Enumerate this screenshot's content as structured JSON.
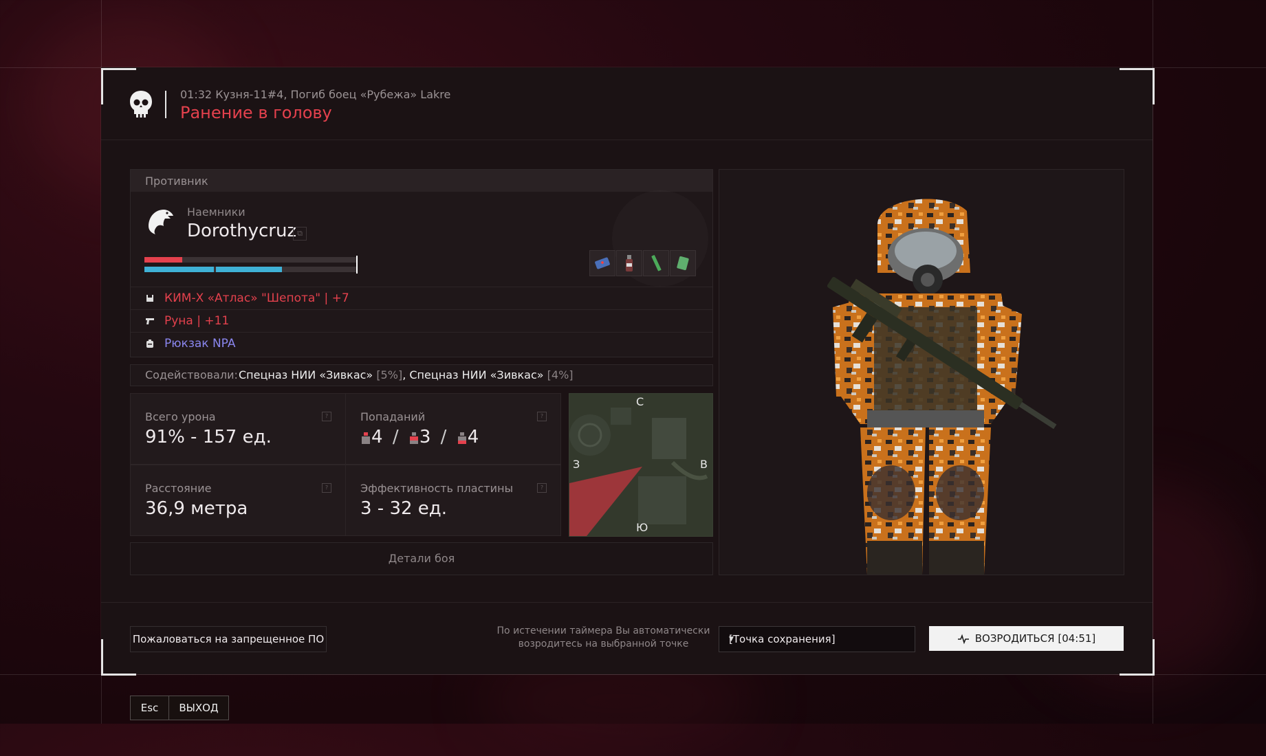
{
  "header": {
    "event_line": "01:32 Кузня-11#4, Погиб боец «Рубежа» Lakre",
    "cause": "Ранение в голову"
  },
  "enemy": {
    "section_title": "Противник",
    "faction": "Наемники",
    "name": "Dorothycruz",
    "health_fraction": 0.18,
    "armor_segments": 3,
    "armor_fraction": 0.65,
    "items": [
      "medkit-icon",
      "bottle-icon",
      "syringe-icon",
      "bandage-icon"
    ],
    "gear": [
      {
        "icon": "armor-icon",
        "text": "КИМ-Х «Атлас» \"Шепота\" | +7",
        "color": "#e4414d"
      },
      {
        "icon": "gun-icon",
        "text": "Руна | +11",
        "color": "#e4414d"
      },
      {
        "icon": "backpack-icon",
        "text": "Рюкзак NPA",
        "color": "#8a86ee"
      }
    ]
  },
  "assist": {
    "label": "Содействовали:",
    "p1": "Спецназ НИИ «Зивкас»",
    "p1_pct": "[5%]",
    "p2": "Спецназ НИИ «Зивкас»",
    "p2_pct": "[4%]"
  },
  "stats": {
    "damage_label": "Всего урона",
    "damage_value": "91% - 157 ед.",
    "hits_label": "Попаданий",
    "hits": [
      "4",
      "3",
      "4"
    ],
    "distance_label": "Расстояние",
    "distance_value": "36,9 метра",
    "plate_label": "Эффективность пластины",
    "plate_value": "3 - 32 ед."
  },
  "minimap": {
    "north": "С",
    "south": "Ю",
    "west": "З",
    "east": "В"
  },
  "details_button": "Детали боя",
  "footer": {
    "report_button": "Пожаловаться на запрещенное ПО",
    "timer_note": "По истечении таймера Вы автоматически возродитесь на выбранной точке",
    "spawn_select": "[Точка сохранения]",
    "respawn_button": "ВОЗРОДИТЬСЯ [04:51]"
  },
  "keys": {
    "esc": "Esc",
    "exit": "ВЫХОД"
  },
  "colors": {
    "accent_red": "#e4414d",
    "armor_blue": "#3fb1d6",
    "rare_purple": "#8a86ee"
  }
}
